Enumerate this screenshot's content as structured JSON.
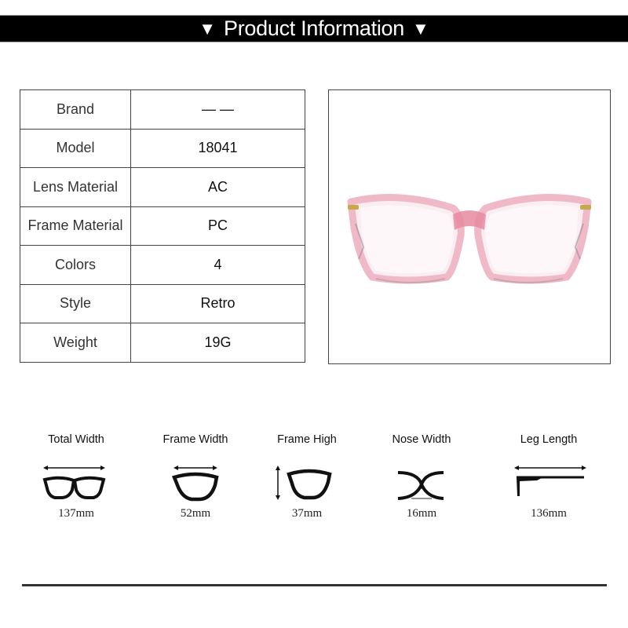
{
  "header": {
    "title": "Product Information",
    "left_icon": "triangle-down-icon",
    "right_icon": "triangle-down-icon",
    "left_glyph": "▼",
    "right_glyph": "▼"
  },
  "specs": [
    {
      "label": "Brand",
      "value": "— —"
    },
    {
      "label": "Model",
      "value": "18041"
    },
    {
      "label": "Lens Material",
      "value": "AC"
    },
    {
      "label": "Frame Material",
      "value": "PC"
    },
    {
      "label": "Colors",
      "value": "4"
    },
    {
      "label": "Style",
      "value": "Retro"
    },
    {
      "label": "Weight",
      "value": "19G"
    }
  ],
  "photo": {
    "subject": "pink crystal cat-eye eyeglasses",
    "frame_color": "#f2c7d1",
    "accent_color": "#e07a90",
    "hinge_color": "#c8a84a"
  },
  "measurements": [
    {
      "label": "Total Width",
      "value": "137mm",
      "icon": "total-width-glasses-icon"
    },
    {
      "label": "Frame Width",
      "value": "52mm",
      "icon": "frame-width-lens-icon"
    },
    {
      "label": "Frame High",
      "value": "37mm",
      "icon": "frame-height-lens-icon"
    },
    {
      "label": "Nose Width",
      "value": "16mm",
      "icon": "nose-bridge-icon"
    },
    {
      "label": "Leg Length",
      "value": "136mm",
      "icon": "temple-arm-icon"
    }
  ]
}
